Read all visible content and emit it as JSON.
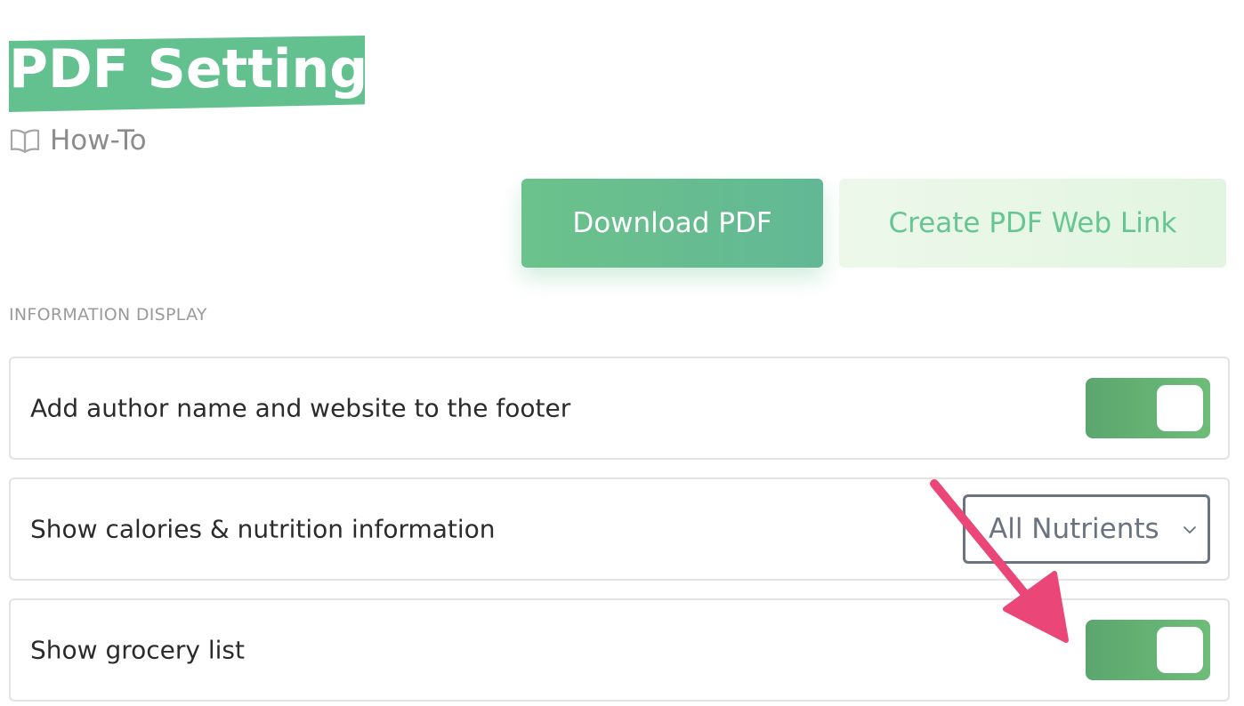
{
  "header": {
    "title": "PDF Settings",
    "howto_label": "How-To",
    "howto_icon": "book-open-icon"
  },
  "actions": {
    "download_label": "Download PDF",
    "weblink_label": "Create PDF Web Link"
  },
  "section": {
    "label": "INFORMATION DISPLAY"
  },
  "settings": [
    {
      "label": "Add author name and website to the footer",
      "control": "toggle",
      "enabled": true
    },
    {
      "label": "Show calories & nutrition information",
      "control": "select",
      "selected": "All Nutrients"
    },
    {
      "label": "Show grocery list",
      "control": "toggle",
      "enabled": true
    }
  ],
  "colors": {
    "brand_green": "#62c18e",
    "toggle_on": "#62ac71",
    "annotation_arrow": "#ea4677",
    "muted_text": "#8c8c8c"
  },
  "annotation": {
    "icon": "arrow-pointer-icon"
  }
}
